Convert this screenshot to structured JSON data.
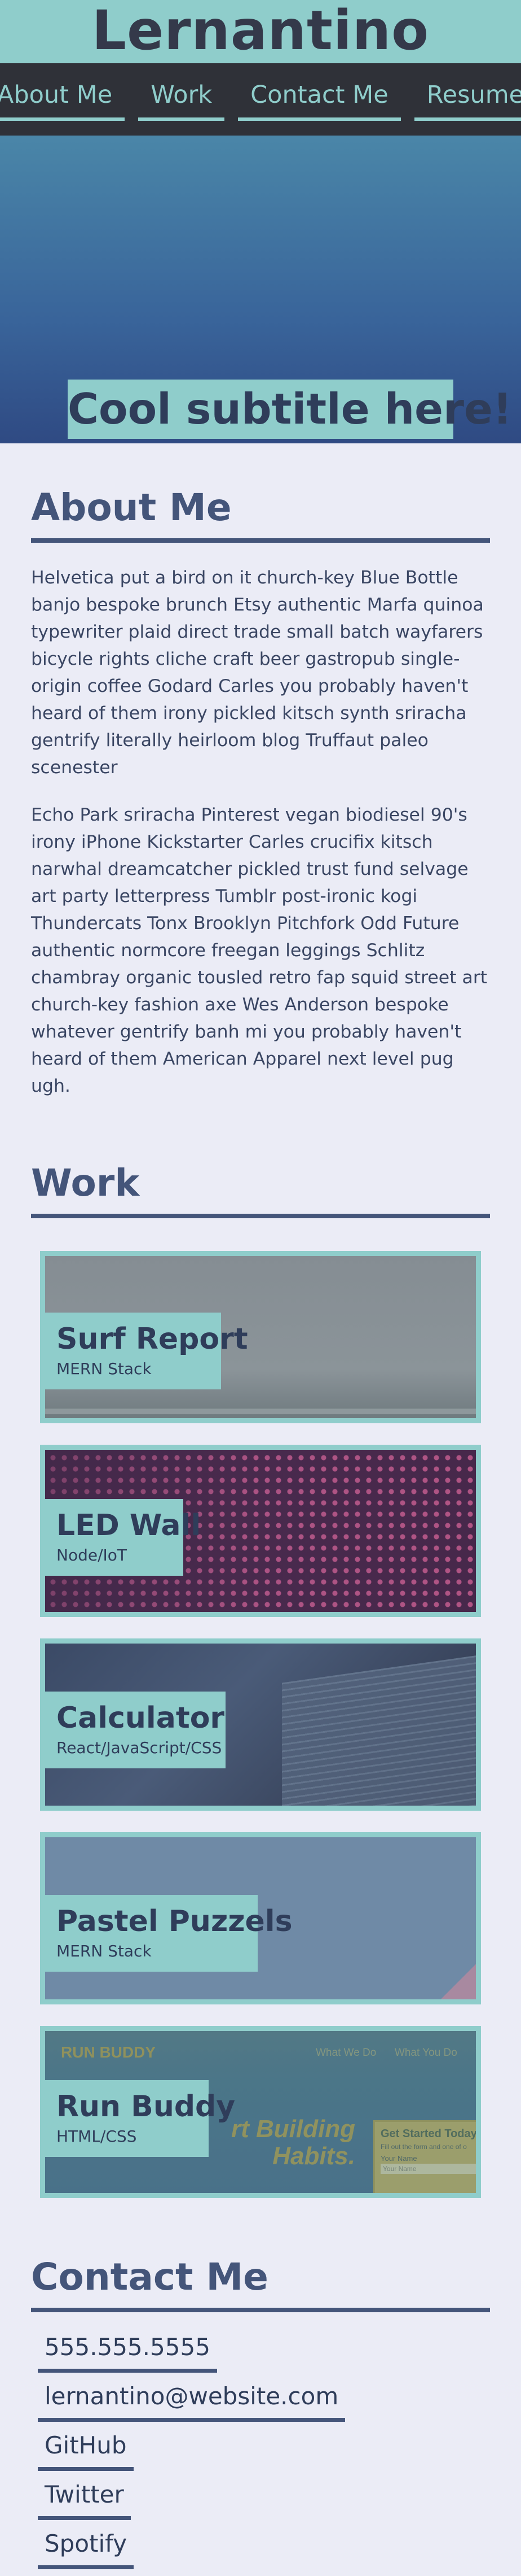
{
  "site": {
    "title": "Lernantino"
  },
  "nav": {
    "items": [
      "About Me",
      "Work",
      "Contact Me",
      "Resume"
    ]
  },
  "hero": {
    "subtitle": "Cool subtitle here!"
  },
  "about": {
    "heading": "About Me",
    "paragraphs": [
      "Helvetica put a bird on it church-key Blue Bottle banjo bespoke brunch Etsy authentic Marfa quinoa typewriter plaid direct trade small batch wayfarers bicycle rights cliche craft beer gastropub single-origin coffee Godard Carles you probably haven't heard of them irony pickled kitsch synth sriracha gentrify literally heirloom blog Truffaut paleo scenester",
      "Echo Park sriracha Pinterest vegan biodiesel 90's irony iPhone Kickstarter Carles crucifix kitsch narwhal dreamcatcher pickled trust fund selvage art party letterpress Tumblr post-ironic kogi Thundercats Tonx Brooklyn Pitchfork Odd Future authentic normcore freegan leggings Schlitz chambray organic tousled retro fap squid street art church-key fashion axe Wes Anderson bespoke whatever gentrify banh mi you probably haven't heard of them American Apparel next level pug ugh."
    ]
  },
  "work": {
    "heading": "Work",
    "projects": [
      {
        "title": "Surf Report",
        "stack": "MERN Stack"
      },
      {
        "title": "LED Wall",
        "stack": "Node/IoT"
      },
      {
        "title": "Calculator",
        "stack": "React/JavaScript/CSS"
      },
      {
        "title": "Pastel Puzzels",
        "stack": "MERN Stack"
      },
      {
        "title": "Run Buddy",
        "stack": "HTML/CSS",
        "thumb_text": {
          "brand": "RUN BUDDY",
          "nav1": "What We Do",
          "nav2": "What You Do",
          "nav3": "Yo",
          "tagline1": "rt Building",
          "tagline2": "Habits.",
          "cta": "Get Started Today",
          "cta_sub": "Fill out the form and one of o",
          "field_label": "Your Name",
          "field_placeholder": "Your Name"
        }
      }
    ]
  },
  "contact": {
    "heading": "Contact Me",
    "items": [
      "555.555.5555",
      "lernantino@website.com",
      "GitHub",
      "Twitter",
      "Spotify"
    ]
  },
  "colors": {
    "accent": "#8fcdcb",
    "nav_bg": "#2f3138",
    "heading": "#44557a",
    "page_bg": "#ebecf6"
  }
}
